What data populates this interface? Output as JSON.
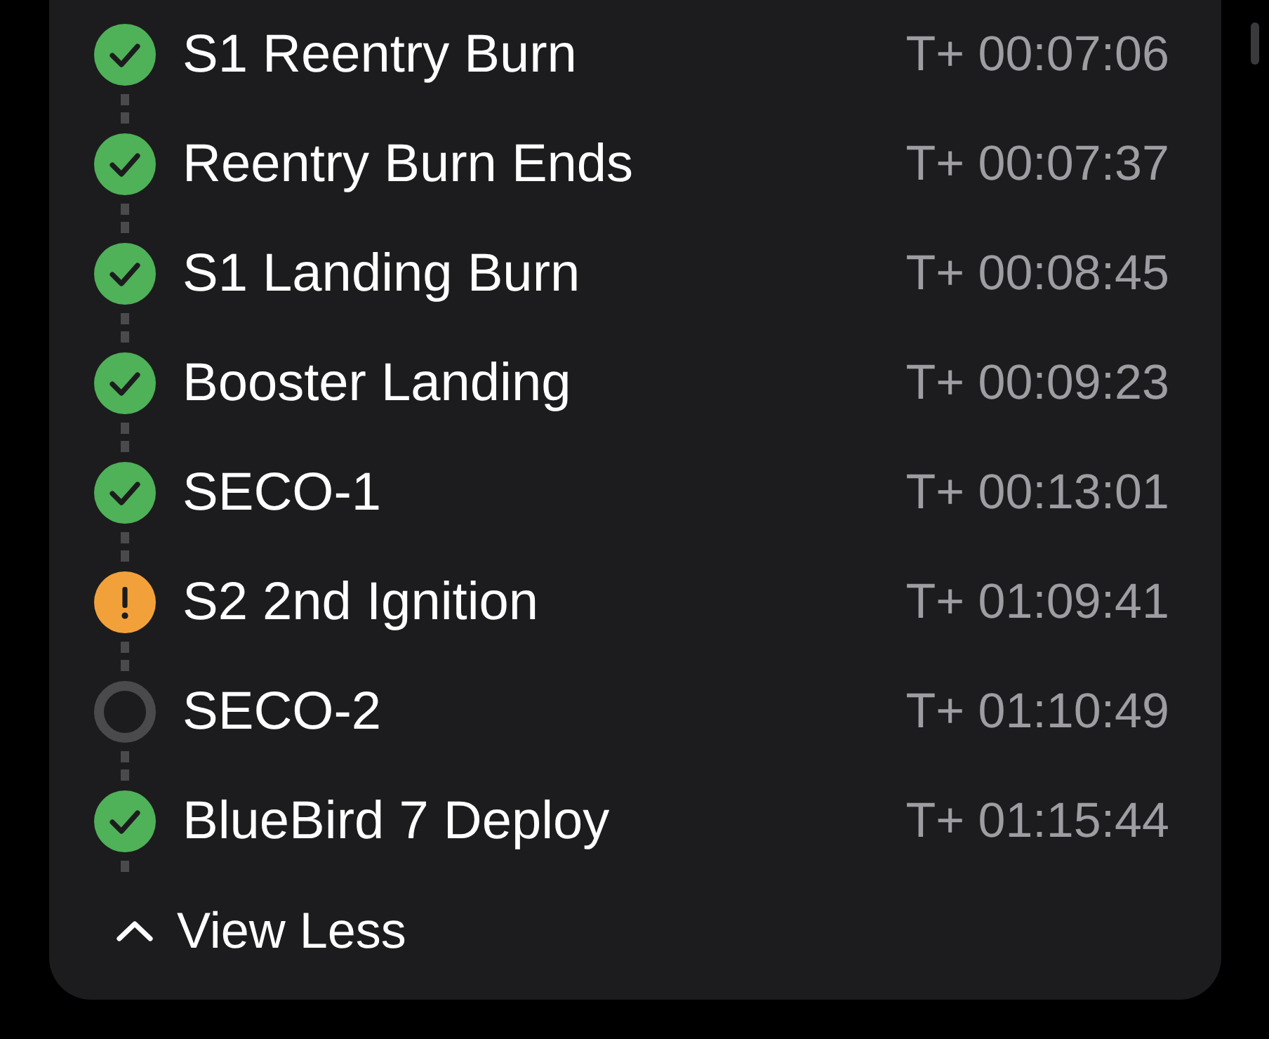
{
  "timeline": {
    "events": [
      {
        "name": "S1 Reentry Burn",
        "time": "T+ 00:07:06",
        "kind": "done"
      },
      {
        "name": "Reentry Burn Ends",
        "time": "T+ 00:07:37",
        "kind": "done"
      },
      {
        "name": "S1 Landing Burn",
        "time": "T+ 00:08:45",
        "kind": "done"
      },
      {
        "name": "Booster Landing",
        "time": "T+ 00:09:23",
        "kind": "done"
      },
      {
        "name": "SECO-1",
        "time": "T+ 00:13:01",
        "kind": "done"
      },
      {
        "name": "S2 2nd Ignition",
        "time": "T+ 01:09:41",
        "kind": "warning"
      },
      {
        "name": "SECO-2",
        "time": "T+ 01:10:49",
        "kind": "pending"
      },
      {
        "name": "BlueBird 7 Deploy",
        "time": "T+ 01:15:44",
        "kind": "done"
      }
    ]
  },
  "toggle": {
    "label": "View Less",
    "expanded": true
  }
}
